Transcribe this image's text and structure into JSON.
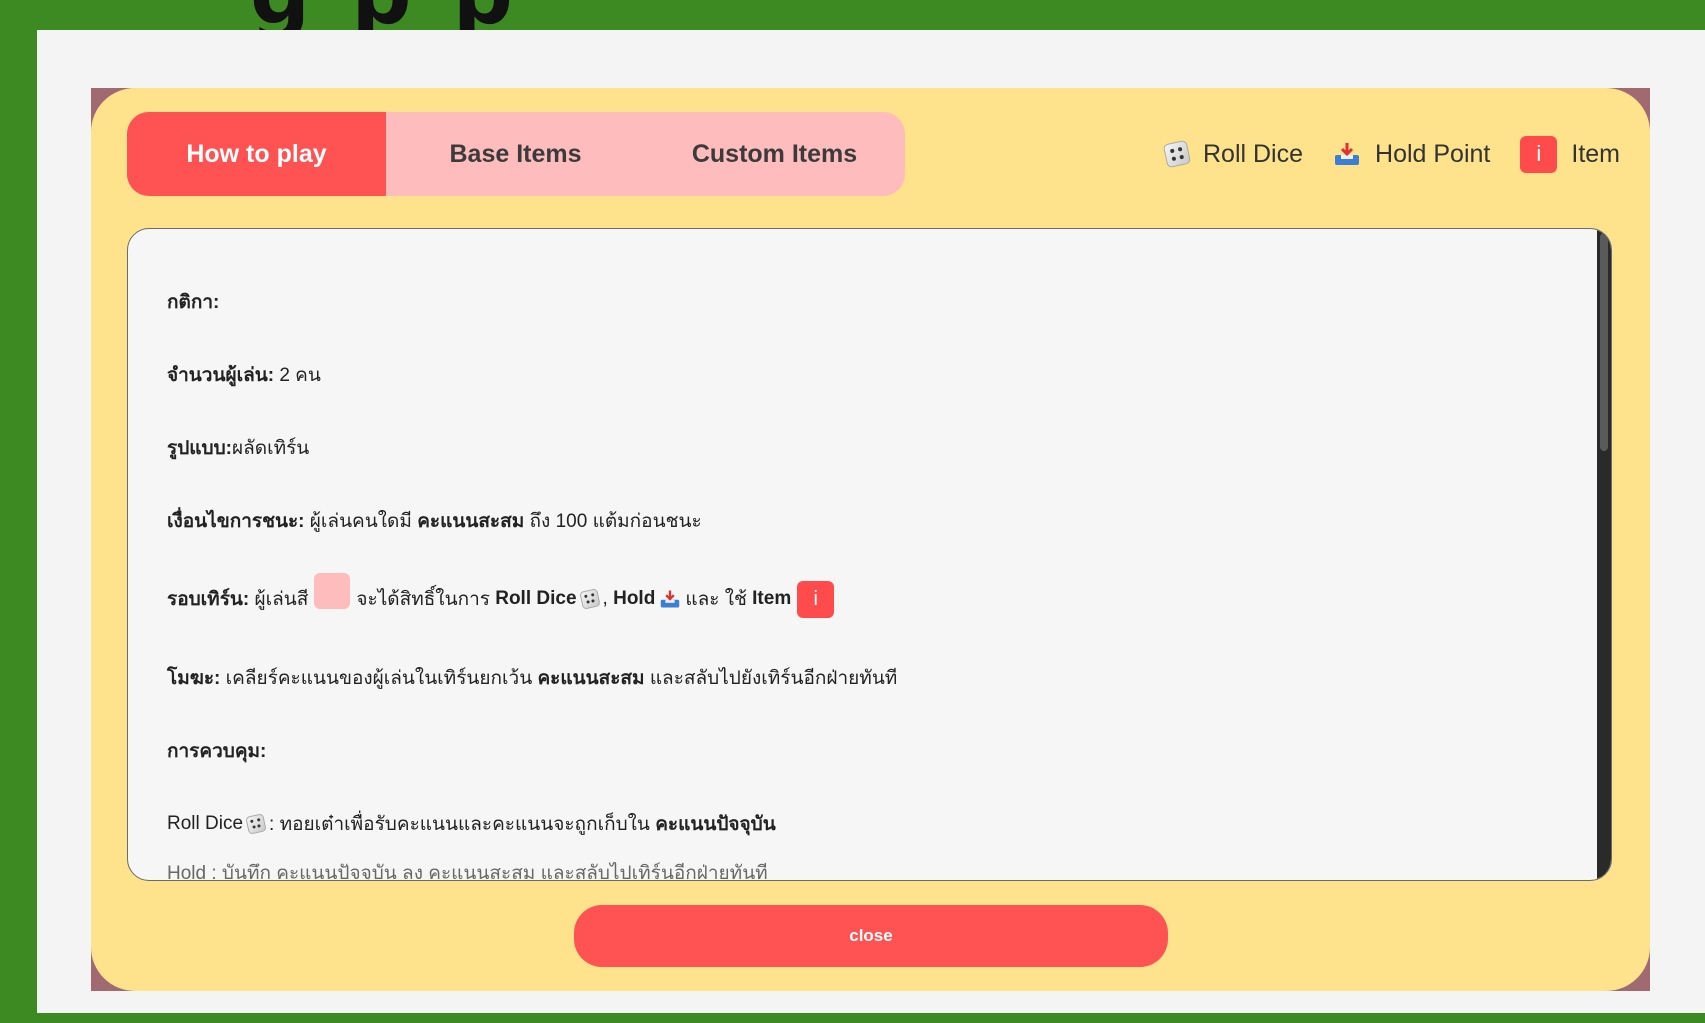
{
  "top_partial_text": "g p p",
  "tabs": [
    {
      "label": "How to play",
      "active": true
    },
    {
      "label": "Base Items",
      "active": false
    },
    {
      "label": "Custom Items",
      "active": false
    }
  ],
  "legend": {
    "roll_label": "Roll Dice",
    "hold_label": "Hold Point",
    "item_glyph": "i",
    "item_label": "Item"
  },
  "rules": {
    "heading": "กติกา:",
    "players_label": "จำนวนผู้เล่น:",
    "players_value": "2 คน",
    "format_label": "รูปแบบ:",
    "format_value": "ผลัดเทิร์น",
    "win_label": "เงื่อนไขการชนะ:",
    "win_text_1": "ผู้เล่นคนใดมี",
    "win_bold": "คะแนนสะสม",
    "win_text_2": "ถึง 100 แต้มก่อนชนะ",
    "turn_label": "รอบเทิร์น:",
    "turn_text_1": "ผู้เล่นสี",
    "turn_text_2": "จะได้สิทธิ์ในการ",
    "turn_roll": "Roll Dice",
    "turn_comma": ",",
    "turn_hold": "Hold",
    "turn_and_use": "และ ใช้",
    "turn_item": "Item",
    "bust_label": "โมฆะ:",
    "bust_text_1": "เคลียร์คะแนนของผู้เล่นในเทิร์นยกเว้น",
    "bust_bold": "คะแนนสะสม",
    "bust_text_2": "และสลับไปยังเทิร์นอีกฝ่ายทันที",
    "controls_label": "การควบคุม:",
    "roll_ctrl_label": "Roll Dice",
    "roll_ctrl_text": ": ทอยเต๋าเพื่อรับคะแนนและคะแนนจะถูกเก็บใน",
    "roll_ctrl_bold": "คะแนนปัจจุบัน",
    "hold_cutoff": "Hold : บันทึก คะแนนปัจจุบัน ลง คะแนนสะสม และสลับไปเทิร์นอีกฝ่ายทันที"
  },
  "close_label": "close",
  "colors": {
    "accent_red": "#ff5252",
    "tab_pink": "#ffbcbc",
    "modal_yellow": "#ffe38c",
    "frame_green": "#3e8a22"
  }
}
